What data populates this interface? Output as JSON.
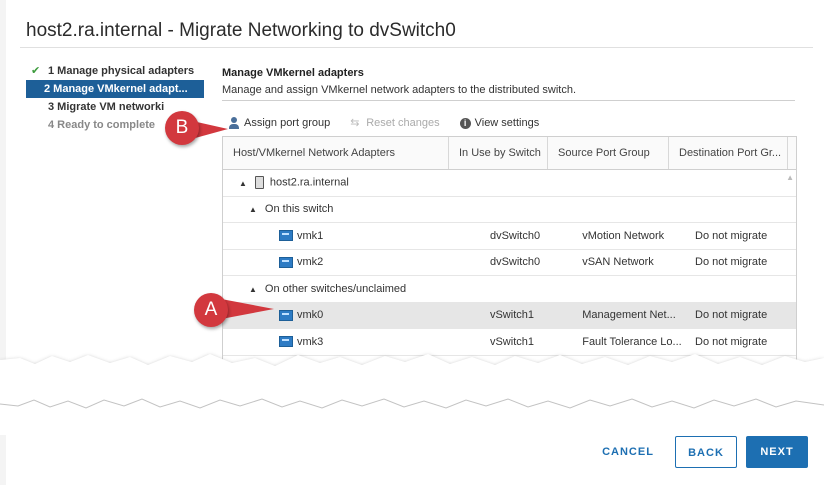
{
  "dialog": {
    "title": "host2.ra.internal - Migrate Networking to dvSwitch0"
  },
  "steps": [
    {
      "label": "1 Manage physical adapters",
      "state": "done"
    },
    {
      "label": "2 Manage VMkernel adapt...",
      "state": "active"
    },
    {
      "label": "3 Migrate VM networki",
      "state": "pending"
    },
    {
      "label": "4 Ready to complete",
      "state": "disabled"
    }
  ],
  "section": {
    "title": "Manage VMkernel adapters",
    "description": "Manage and assign VMkernel network adapters to the distributed switch."
  },
  "toolbar": {
    "assign": "Assign port group",
    "reset": "Reset changes",
    "view": "View settings"
  },
  "table": {
    "headers": [
      "Host/VMkernel Network Adapters",
      "In Use by Switch",
      "Source Port Group",
      "Destination Port Gr..."
    ],
    "host": "host2.ra.internal",
    "group_on_switch": "On this switch",
    "group_other": "On other switches/unclaimed",
    "rows_on_switch": [
      {
        "adapter": "vmk1",
        "switch": "dvSwitch0",
        "source": "vMotion Network",
        "dest": "Do not migrate"
      },
      {
        "adapter": "vmk2",
        "switch": "dvSwitch0",
        "source": "vSAN Network",
        "dest": "Do not migrate"
      }
    ],
    "rows_other": [
      {
        "adapter": "vmk0",
        "switch": "vSwitch1",
        "source": "Management Net...",
        "dest": "Do not migrate"
      },
      {
        "adapter": "vmk3",
        "switch": "vSwitch1",
        "source": "Fault Tolerance Lo...",
        "dest": "Do not migrate"
      }
    ]
  },
  "callouts": {
    "a": "A",
    "b": "B"
  },
  "footer": {
    "cancel": "CANCEL",
    "back": "BACK",
    "next": "NEXT"
  },
  "colors": {
    "accent": "#1d6fb2",
    "active_step": "#1d5f98",
    "callout": "#d2383e",
    "check": "#3c9b3c"
  }
}
